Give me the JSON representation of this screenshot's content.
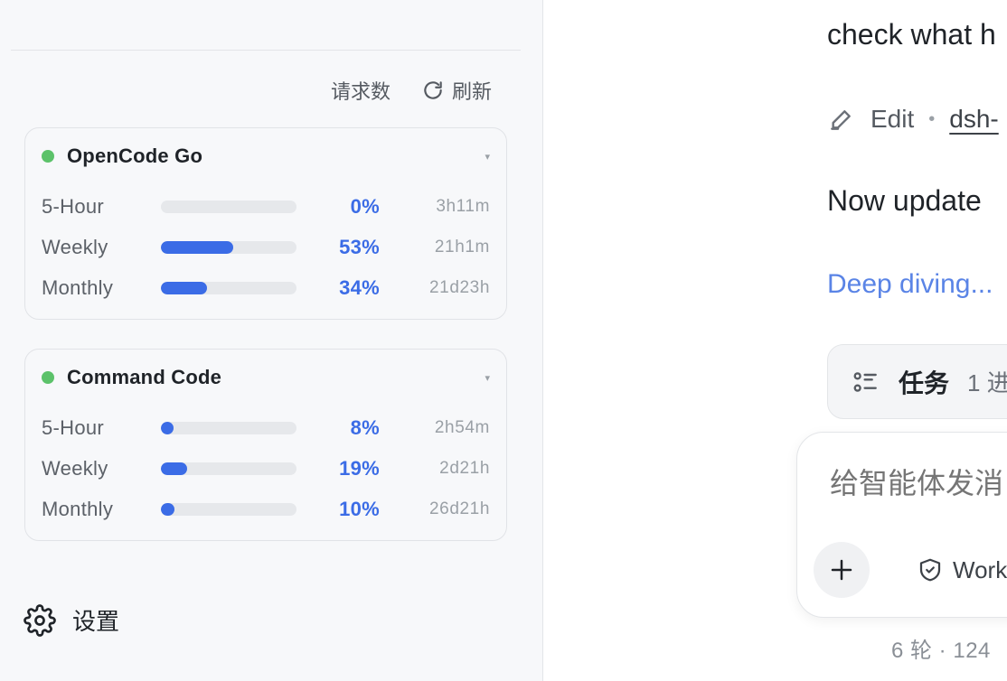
{
  "sidebar": {
    "toolbar": {
      "requests_label": "请求数",
      "refresh_label": "刷新"
    },
    "providers": [
      {
        "name": "OpenCode Go",
        "status_color": "#5cc26a",
        "metrics": [
          {
            "label": "5-Hour",
            "percent": 0,
            "percent_text": "0%",
            "reset": "3h11m"
          },
          {
            "label": "Weekly",
            "percent": 53,
            "percent_text": "53%",
            "reset": "21h1m"
          },
          {
            "label": "Monthly",
            "percent": 34,
            "percent_text": "34%",
            "reset": "21d23h"
          }
        ]
      },
      {
        "name": "Command Code",
        "status_color": "#5cc26a",
        "metrics": [
          {
            "label": "5-Hour",
            "percent": 8,
            "percent_text": "8%",
            "reset": "2h54m"
          },
          {
            "label": "Weekly",
            "percent": 19,
            "percent_text": "19%",
            "reset": "2d21h"
          },
          {
            "label": "Monthly",
            "percent": 10,
            "percent_text": "10%",
            "reset": "26d21h"
          }
        ]
      }
    ],
    "settings_label": "设置"
  },
  "chat": {
    "message_1": "check what h",
    "edit_label": "Edit",
    "edit_commit": "dsh-",
    "message_2": "Now update",
    "status_link": "Deep diving...",
    "task": {
      "title": "任务",
      "count": "1 进"
    },
    "composer": {
      "placeholder": "给智能体发消",
      "workspace_label": "Work"
    },
    "footer_stats": "6 轮 · 124 "
  },
  "colors": {
    "accent": "#3b6ce6",
    "link": "#5a84e6",
    "status_ok": "#5cc26a"
  }
}
